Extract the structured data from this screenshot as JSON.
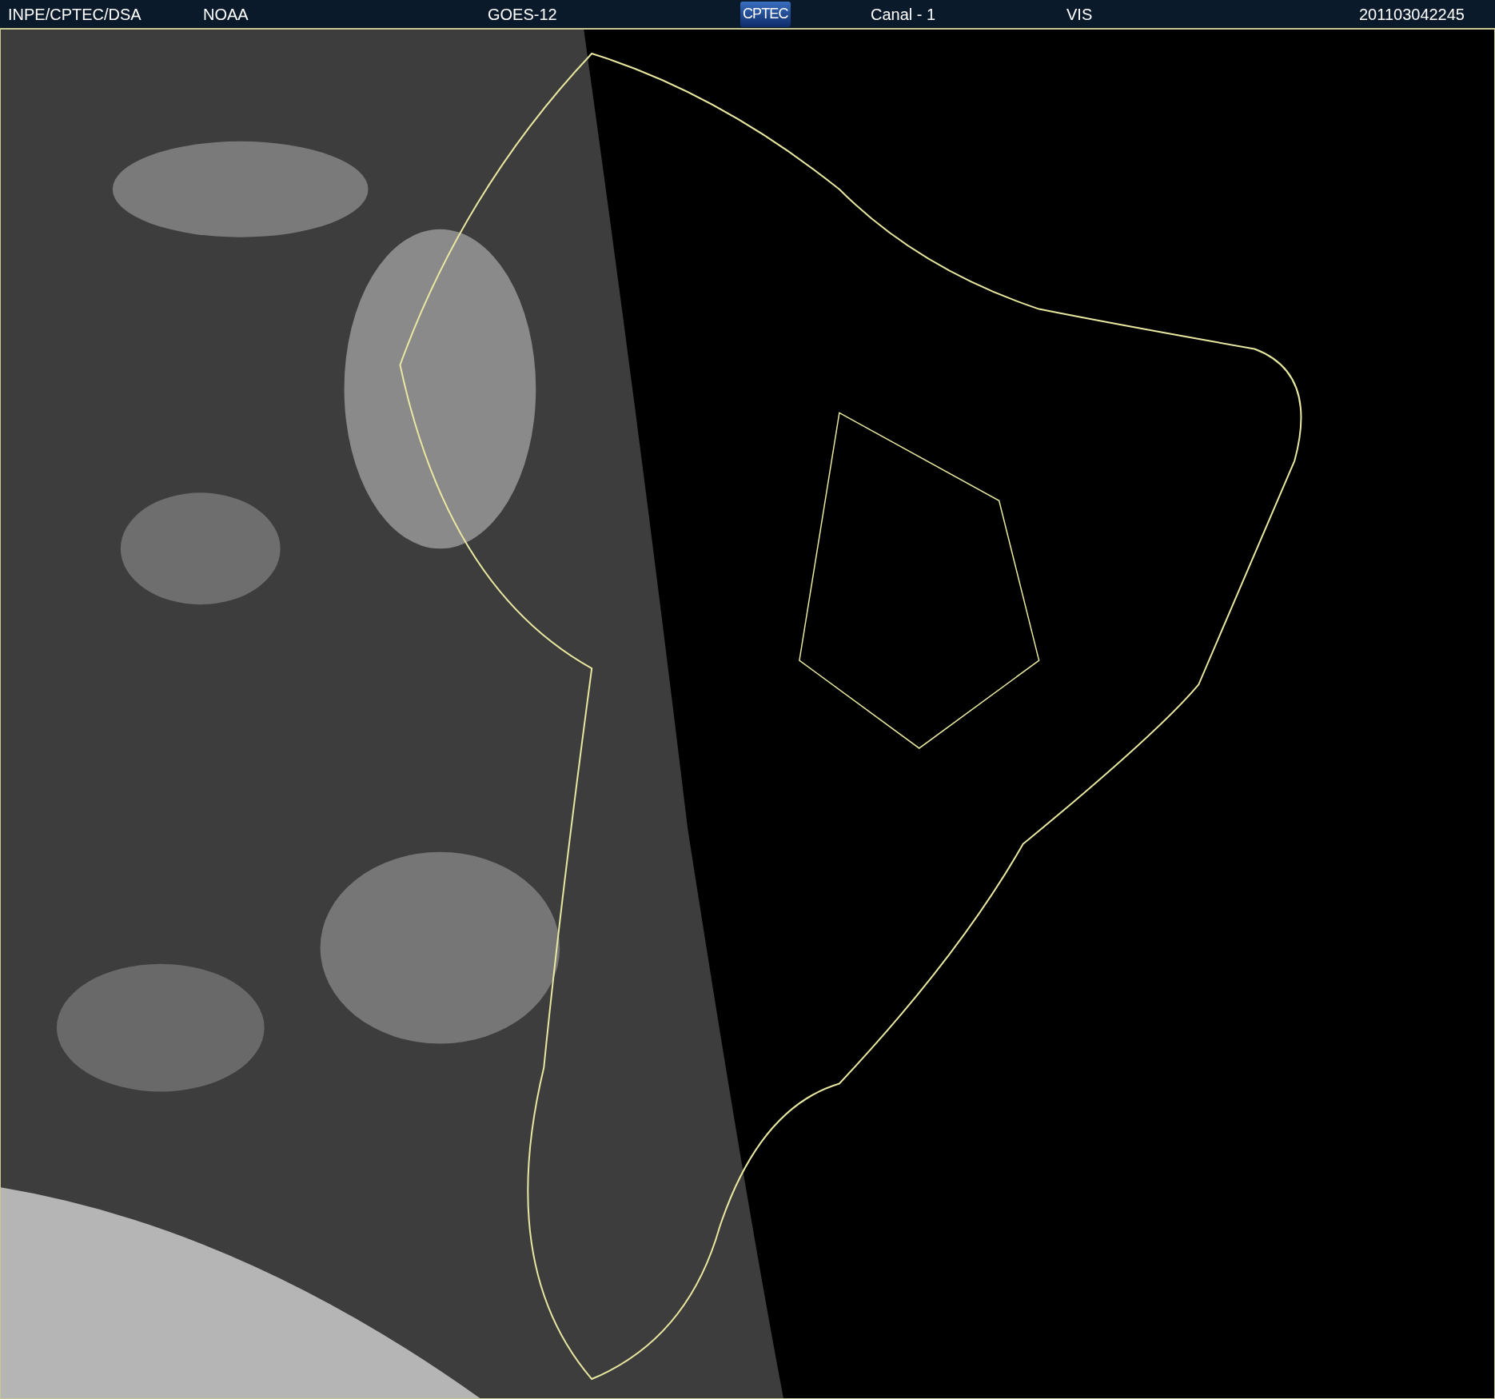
{
  "header": {
    "items": [
      {
        "kind": "text",
        "text": "INPE/CPTEC/DSA"
      },
      {
        "kind": "text",
        "text": "NOAA"
      },
      {
        "kind": "text",
        "text": "GOES-12"
      },
      {
        "kind": "logo",
        "text": "CPTEC"
      },
      {
        "kind": "text",
        "text": "Canal - 1"
      },
      {
        "kind": "text",
        "text": "VIS"
      },
      {
        "kind": "text",
        "text": "201103042245"
      }
    ]
  }
}
